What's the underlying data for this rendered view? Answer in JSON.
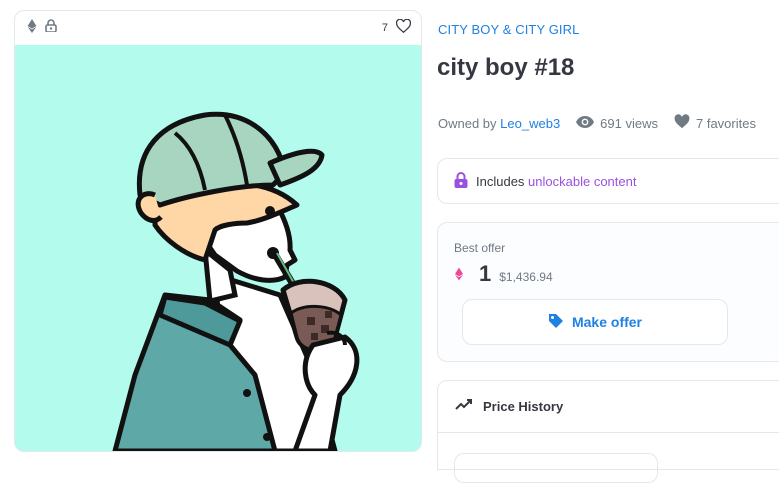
{
  "asset_card": {
    "favorites_count": "7",
    "chain_icon": "ethereum-icon",
    "lock_icon": "lock-icon",
    "heart_icon": "heart-icon",
    "artwork_background": "#b2fbed"
  },
  "collection_name": "CITY BOY & CITY GIRL",
  "item_title": "city boy #18",
  "meta": {
    "owned_by_label": "Owned by",
    "owner_name": "Leo_web3",
    "views_text": "691 views",
    "favorites_text": "7 favorites"
  },
  "unlockable": {
    "prefix": "Includes",
    "highlight": "unlockable content"
  },
  "offer": {
    "label": "Best offer",
    "amount": "1",
    "usd": "$1,436.94",
    "button_label": "Make offer"
  },
  "price_history": {
    "title": "Price History"
  },
  "colors": {
    "link": "#2081e2",
    "accent_purple": "#9b51e0",
    "text": "#353840",
    "muted": "#707a83",
    "weth_pink": "#ec4899"
  }
}
